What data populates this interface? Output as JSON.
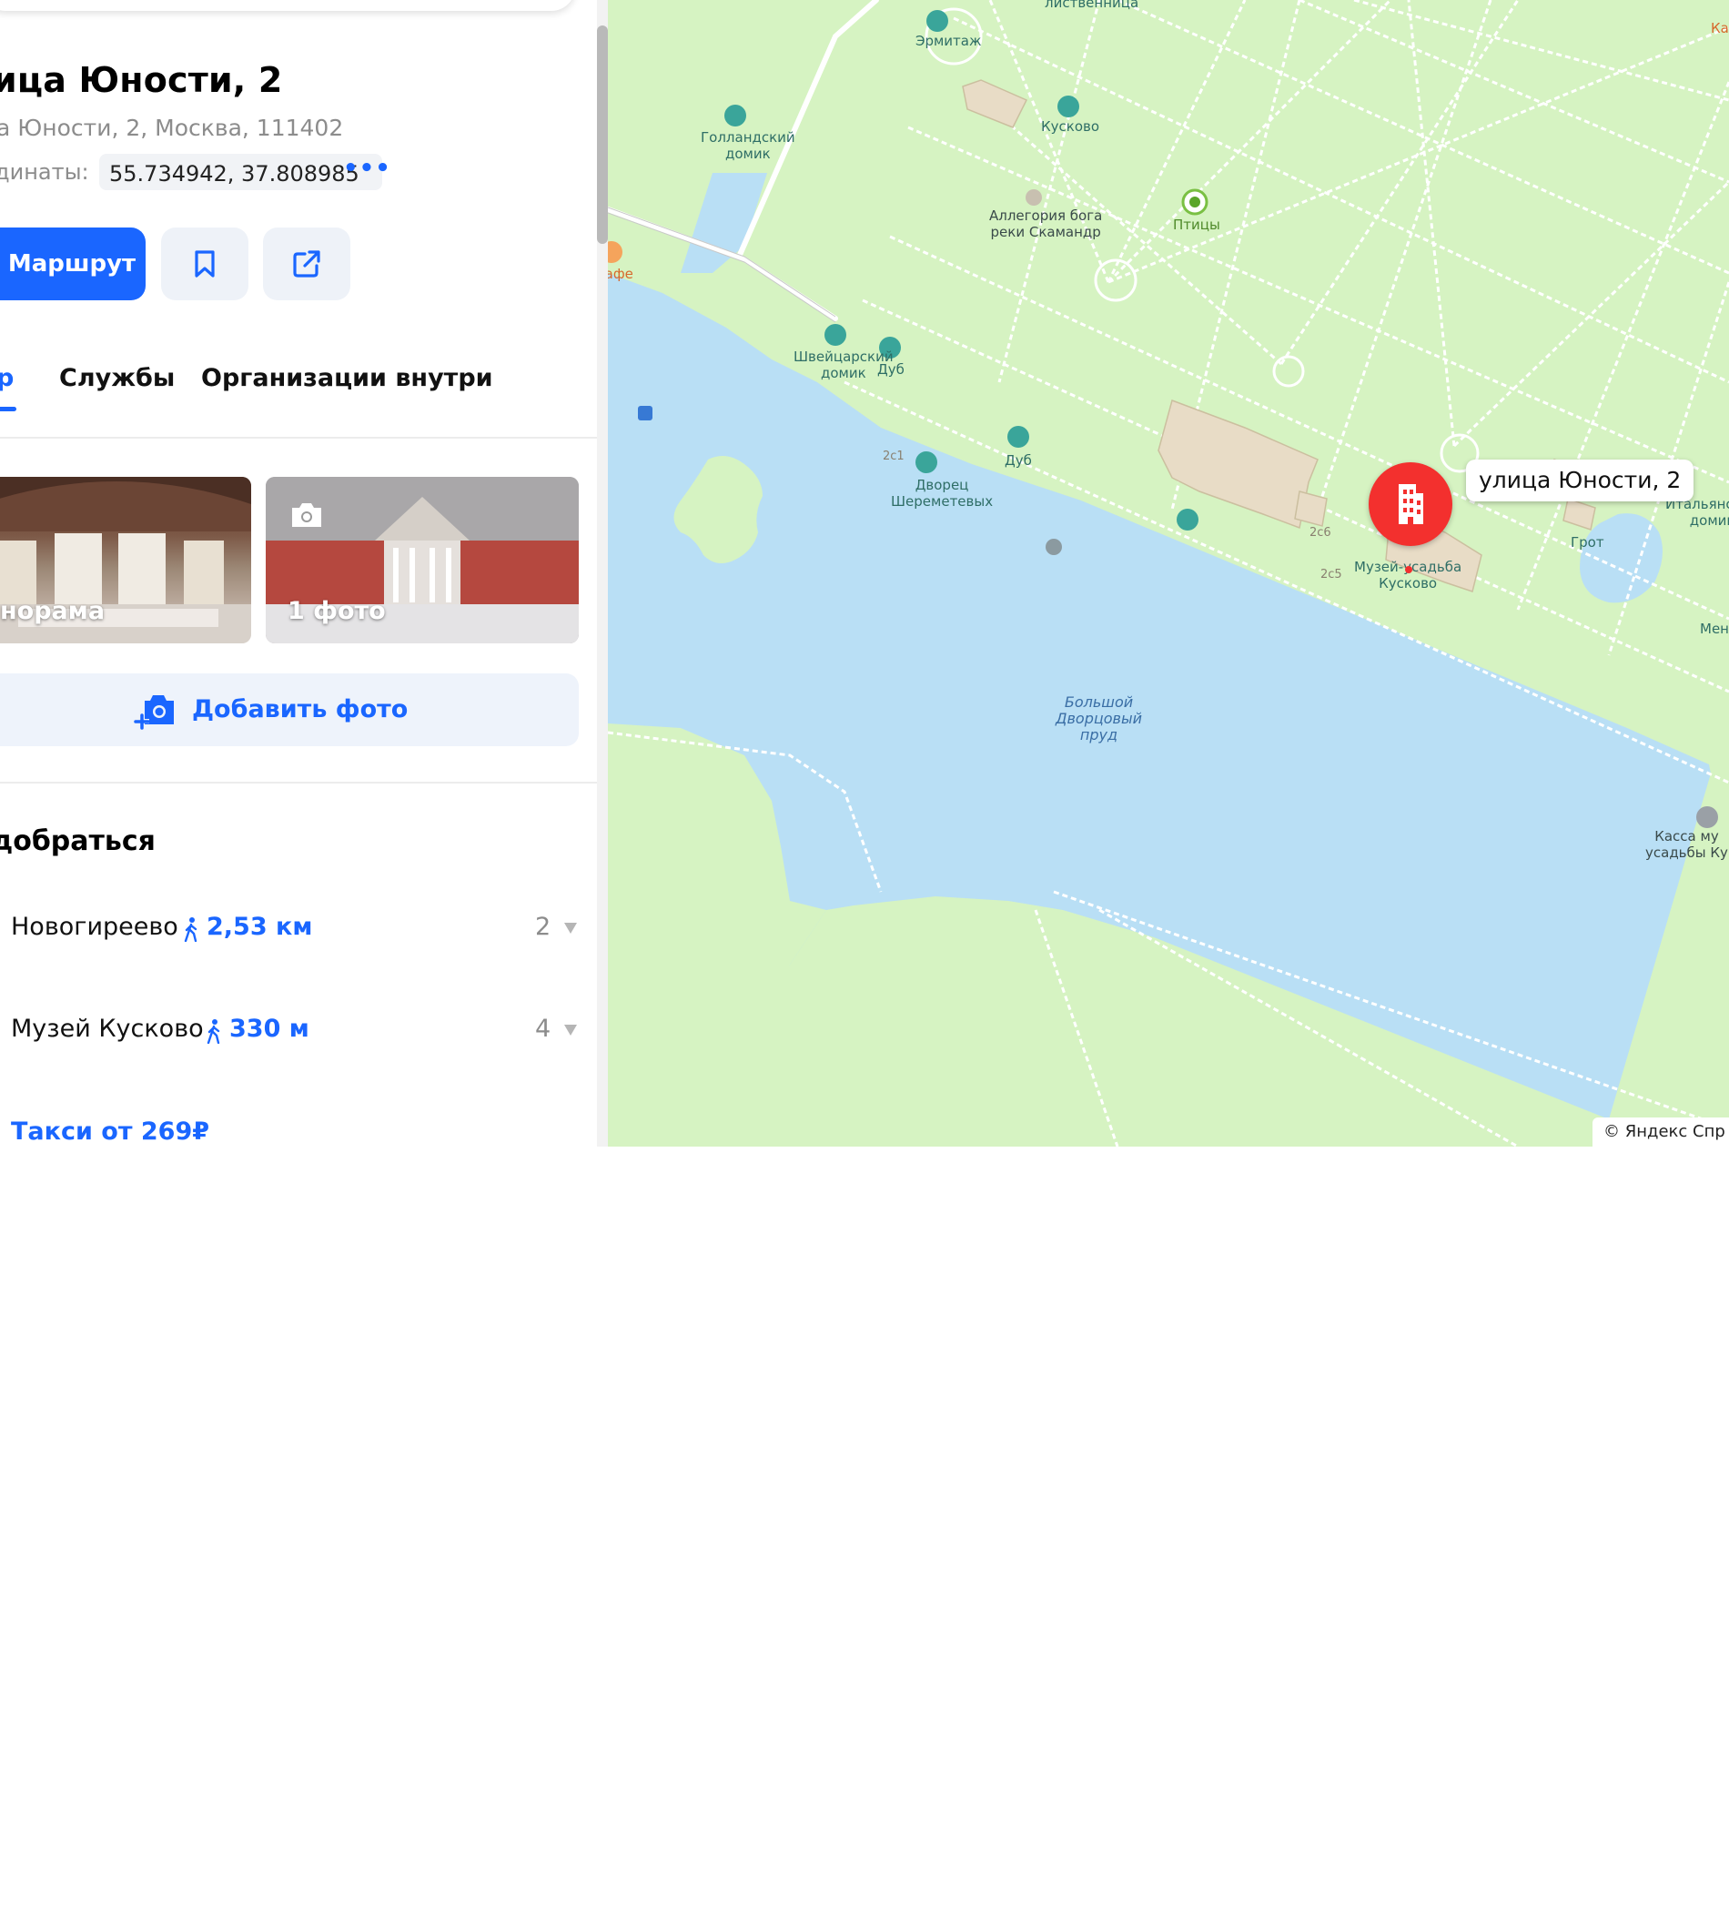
{
  "place": {
    "title": "ица Юности, 2",
    "address": "а Юности, 2, Москва, 111402",
    "coords_label": "динаты:",
    "coords_value": "55.734942, 37.808985",
    "coords_more": "•••"
  },
  "actions": {
    "route_label": "Маршрут",
    "bookmark_icon": "bookmark-icon",
    "share_icon": "share-icon"
  },
  "tabs": {
    "overview": "р",
    "services": "Службы",
    "orgs": "Организации внутри"
  },
  "photos": {
    "panorama_label": "норама",
    "photos_label": "1 фото",
    "add_photo_label": "Добавить фото"
  },
  "howto": {
    "title": "добраться",
    "stops": [
      {
        "name": "Новогиреево",
        "distance": "2,53 км",
        "count": "2"
      },
      {
        "name": "Музей Кусково",
        "distance": "330 м",
        "count": "4"
      }
    ],
    "taxi": "Такси от 269₽"
  },
  "map": {
    "address_label": "улица Юности, 2",
    "attribution": "© Яндекс  Спр",
    "labels": {
      "hermitage": "Эрмитаж",
      "kuskovo": "Кусково",
      "dutch_house": "Голландский\nдомик",
      "allegory": "Аллегория бога\nреки Скамандр",
      "birds": "Птицы",
      "cafe": "Кафе",
      "swiss_house": "Швейцарский\nдомик",
      "oak1": "Дуб",
      "oak2": "Дуб",
      "palace": "Дворец\nШереметевых",
      "italian_house": "Итальянский\nдомик",
      "grotto": "Грот",
      "museum": "Музей-усадьба\nКусково",
      "pond": "Большой\nДворцовый\nпруд",
      "kassa": "Касса му\nусадьбы Ку",
      "menagerie": "Мен",
      "ka": "Ка",
      "top_cut": "лиственница",
      "bld_2c1": "2с1",
      "bld_2c6": "2с6",
      "bld_2c5": "2с5"
    }
  },
  "colors": {
    "accent": "#1a66ff",
    "pin": "#f3302e",
    "water": "#b9dff5",
    "park": "#d6f3c2"
  }
}
